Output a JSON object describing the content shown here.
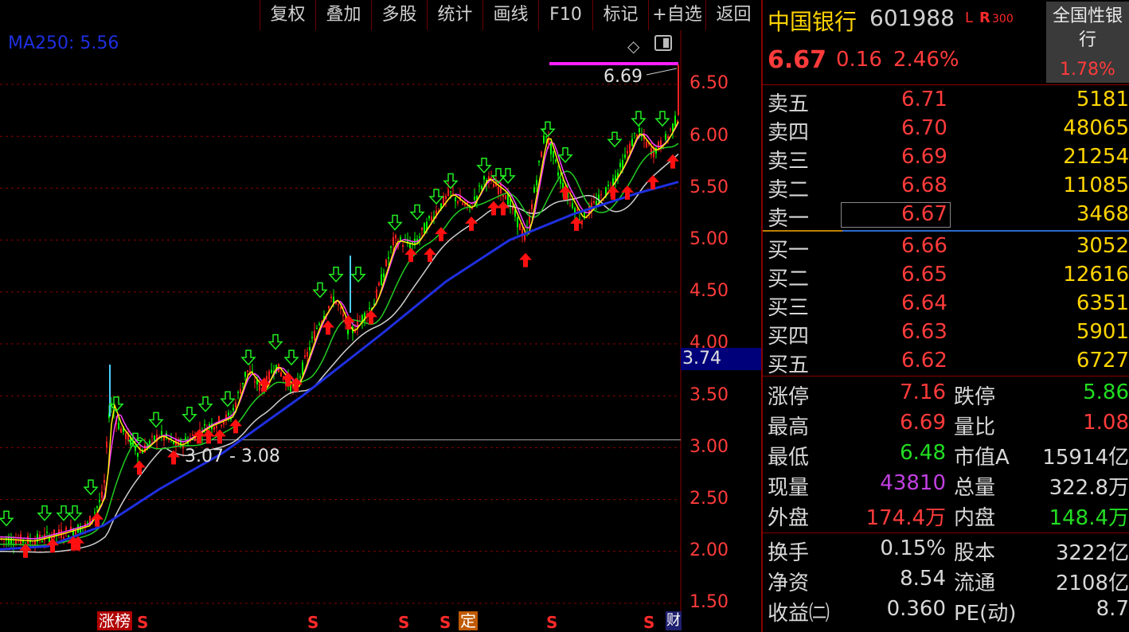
{
  "toolbar": {
    "buttons": [
      "复权",
      "叠加",
      "多股",
      "统计",
      "画线",
      "F10",
      "标记",
      "+自选",
      "返回"
    ]
  },
  "chart": {
    "ma_label": "MA250: 5.56",
    "y_ticks": [
      "6.50",
      "6.00",
      "5.50",
      "5.00",
      "4.50",
      "4.00",
      "3.50",
      "3.00",
      "2.50",
      "2.00",
      "1.50"
    ],
    "current_price_tag": "3.74",
    "high_annotation": "6.69",
    "range_annotation": "3.07 - 3.08",
    "markers": {
      "zhangbang": "涨榜",
      "s": "S",
      "ding": "定",
      "cai": "财"
    },
    "colors": {
      "ma250": "#1f2fe0",
      "ma_white": "#e0e0e0",
      "ma_green": "#22cc22",
      "ma_yellow": "#ffee00",
      "ma_magenta": "#ff40ff",
      "up": "#ff2020",
      "down": "#00ff00"
    }
  },
  "quote": {
    "name": "中国银行",
    "code": "601988",
    "tag_l": "L",
    "tag_r": "R",
    "tag_300": "300",
    "industry": "全国性银行",
    "industry_change": "1.78%",
    "price": "6.67",
    "change": "0.16",
    "change_pct": "2.46%",
    "asks": [
      {
        "label": "卖五",
        "price": "6.71",
        "vol": "5181"
      },
      {
        "label": "卖四",
        "price": "6.70",
        "vol": "48065"
      },
      {
        "label": "卖三",
        "price": "6.69",
        "vol": "21254"
      },
      {
        "label": "卖二",
        "price": "6.68",
        "vol": "11085"
      },
      {
        "label": "卖一",
        "price": "6.67",
        "vol": "3468"
      }
    ],
    "bids": [
      {
        "label": "买一",
        "price": "6.66",
        "vol": "3052"
      },
      {
        "label": "买二",
        "price": "6.65",
        "vol": "12616"
      },
      {
        "label": "买三",
        "price": "6.64",
        "vol": "6351"
      },
      {
        "label": "买四",
        "price": "6.63",
        "vol": "5901"
      },
      {
        "label": "买五",
        "price": "6.62",
        "vol": "6727"
      }
    ],
    "stats1": [
      {
        "l1": "涨停",
        "v1": "7.16",
        "c1": "#ff3b3b",
        "l2": "跌停",
        "v2": "5.86",
        "c2": "#22dd22"
      },
      {
        "l1": "最高",
        "v1": "6.69",
        "c1": "#ff3b3b",
        "l2": "量比",
        "v2": "1.08",
        "c2": "#ff3b3b"
      },
      {
        "l1": "最低",
        "v1": "6.48",
        "c1": "#22dd22",
        "l2": "市值A",
        "v2": "15914亿",
        "c2": "#d8d8d8"
      },
      {
        "l1": "现量",
        "v1": "43810",
        "c1": "#c040e0",
        "l2": "总量",
        "v2": "322.8万",
        "c2": "#d8d8d8"
      },
      {
        "l1": "外盘",
        "v1": "174.4万",
        "c1": "#ff3b3b",
        "l2": "内盘",
        "v2": "148.4万",
        "c2": "#22dd22"
      }
    ],
    "stats2": [
      {
        "l1": "换手",
        "v1": "0.15%",
        "c1": "#d8d8d8",
        "l2": "股本",
        "v2": "3222亿",
        "c2": "#d8d8d8"
      },
      {
        "l1": "净资",
        "v1": "8.54",
        "c1": "#d8d8d8",
        "l2": "流通",
        "v2": "2108亿",
        "c2": "#d8d8d8"
      },
      {
        "l1": "收益㈡",
        "v1": "0.360",
        "c1": "#d8d8d8",
        "l2": "PE(动)",
        "v2": "8.7",
        "c2": "#d8d8d8"
      }
    ]
  }
}
